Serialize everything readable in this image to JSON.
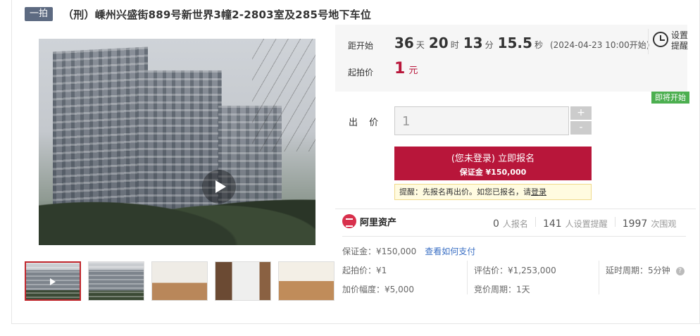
{
  "title": {
    "badge": "一拍",
    "text": "（刑）嵊州兴盛街889号新世界3幢2-2803室及285号地下车位"
  },
  "countdown": {
    "label": "距开始",
    "days": "36",
    "days_unit": "天",
    "hours": "20",
    "hours_unit": "时",
    "minutes": "13",
    "minutes_unit": "分",
    "seconds": "15.5",
    "seconds_unit": "秒",
    "start_time": "(2024-04-23 10:00开始)"
  },
  "start_price": {
    "label": "起拍价",
    "value": "1",
    "unit": "元"
  },
  "reminder": {
    "label_line1": "设置",
    "label_line2": "提醒"
  },
  "status_badge": "即将开始",
  "bid": {
    "label": "出 价",
    "value": "1",
    "plus": "+",
    "minus": "-"
  },
  "signup": {
    "line1": "(您未登录) 立即报名",
    "line2": "保证金 ¥150,000"
  },
  "tip": {
    "text": "提醒：先报名再出价。如您已报名，请",
    "login": "登录"
  },
  "platform": {
    "name": "阿里资产"
  },
  "stats": {
    "signups": "0",
    "signups_label": "人报名",
    "reminders": "141",
    "reminders_label": "人设置提醒",
    "views": "1997",
    "views_label": "次围观"
  },
  "details": {
    "deposit": "保证金：¥150,000",
    "pay_link": "查看如何支付",
    "start_price": "起拍价：¥1",
    "increment": "加价幅度：¥5,000",
    "valuation": "评估价：¥1,253,000",
    "bid_cycle": "竞价周期：1天",
    "delay_cycle": "延时周期：5分钟"
  },
  "icons": {
    "alarm": "alarm-clock-icon",
    "play": "play-icon",
    "help": "help-icon",
    "platform_logo": "ali-assets-logo"
  },
  "colors": {
    "accent": "#b8163a",
    "badge": "#5d6a81",
    "status_green": "#4caf50",
    "link": "#3a6fc4"
  }
}
